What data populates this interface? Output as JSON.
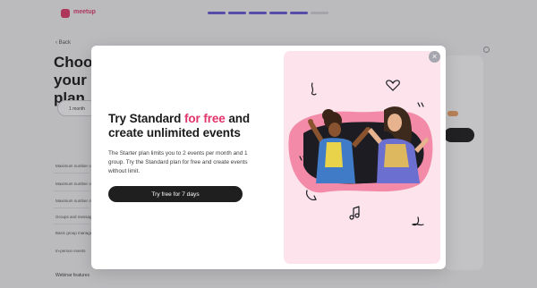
{
  "background": {
    "brand": "meetup",
    "back_label": "Back",
    "title": "Choose your plan",
    "toggle_label": "1 month",
    "features": [
      "Maximum number of events",
      "Maximum number of groups",
      "Maximum number of members",
      "Groups and messages",
      "Basic group management Event Store",
      "In-person events"
    ],
    "webinar_label": "Webinar features"
  },
  "modal": {
    "title_part1": "Try Standard ",
    "title_highlight": "for free",
    "title_part2": " and create unlimited events",
    "description": "The Starter plan limits you to 2 events per month and 1 group. Try the Standard plan for free and create events without limit.",
    "cta_label": "Try free for 7 days",
    "close_glyph": "×"
  },
  "colors": {
    "accent": "#e2336b",
    "button": "#1f1f1f",
    "promo_bg": "#fde4ec",
    "blob": "#f28aa8",
    "progress": "#6a5ad6"
  },
  "icons": [
    "close-icon",
    "heart-icon",
    "music-note-icon",
    "phone-icon"
  ]
}
